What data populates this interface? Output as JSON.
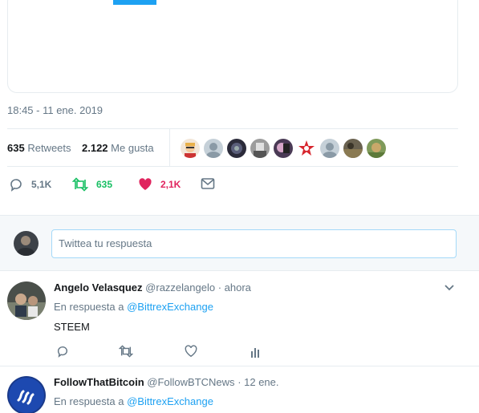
{
  "tweet": {
    "timestamp": "18:45 - 11 ene. 2019",
    "retweets_count": "635",
    "retweets_label": "Retweets",
    "likes_count": "2.122",
    "likes_label": "Me gusta",
    "actions": {
      "replies": "5,1K",
      "retweets": "635",
      "likes": "2,1K"
    }
  },
  "reply_box": {
    "placeholder": "Twittea tu respuesta"
  },
  "replies": [
    {
      "name": "Angelo Velasquez",
      "handle": "@razzelangelo",
      "time": "· ahora",
      "in_reply_prefix": "En respuesta a",
      "in_reply_mention": "@BittrexExchange",
      "text": "STEEM"
    },
    {
      "name": "FollowThatBitcoin",
      "handle": "@FollowBTCNews",
      "time": "· 12 ene.",
      "in_reply_prefix": "En respuesta a",
      "in_reply_mention": "@BittrexExchange"
    }
  ],
  "colors": {
    "accent": "#1da1f2",
    "retweet_green": "#17bf63",
    "like_red": "#e0245e",
    "muted": "#657786"
  }
}
